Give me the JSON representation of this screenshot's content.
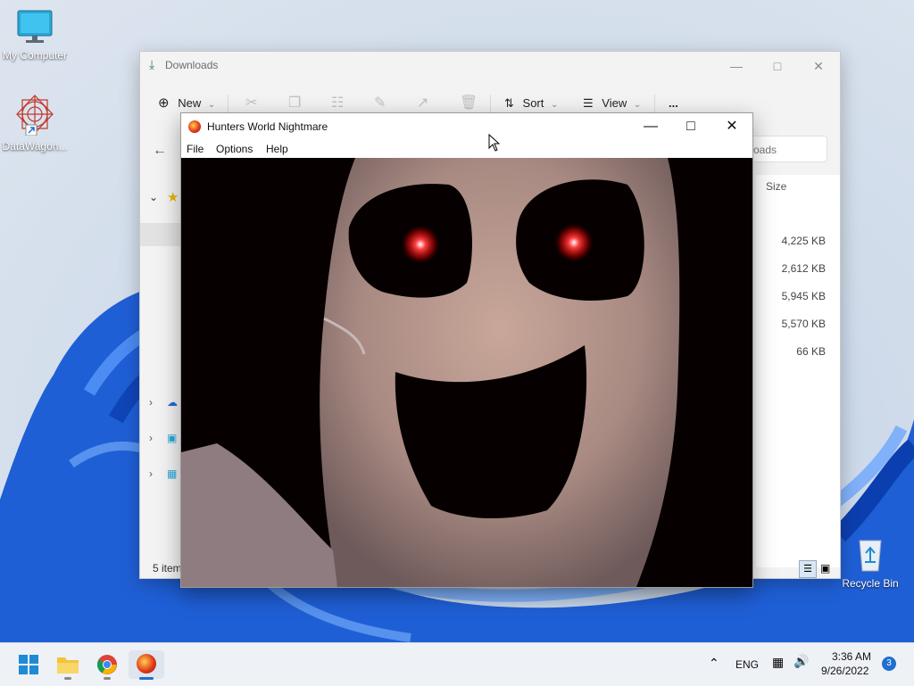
{
  "desktop": {
    "icons": [
      {
        "label": "My Computer",
        "icon": "monitor-icon"
      },
      {
        "label": "DataWagon...",
        "icon": "datawagon-shortcut-icon"
      },
      {
        "label": "Recycle Bin",
        "icon": "recycle-bin-icon"
      }
    ]
  },
  "explorer": {
    "title": "Downloads",
    "toolbar": {
      "new_label": "New",
      "sort_label": "Sort",
      "view_label": "View",
      "more_label": "..."
    },
    "search_placeholder": "oads",
    "columns": {
      "size": "Size"
    },
    "sizes": [
      "4,225 KB",
      "2,612 KB",
      "5,945 KB",
      "5,570 KB",
      "66 KB"
    ],
    "status": "5 item"
  },
  "game": {
    "title": "Hunters World Nightmare",
    "menu": [
      "File",
      "Options",
      "Help"
    ],
    "eye_color": "#ff1a1a"
  },
  "taskbar": {
    "apps": [
      "start-icon",
      "file-explorer-icon",
      "chrome-icon",
      "game-app-icon"
    ],
    "language": "ENG",
    "time": "3:36 AM",
    "date": "9/26/2022",
    "notification_count": "3"
  }
}
